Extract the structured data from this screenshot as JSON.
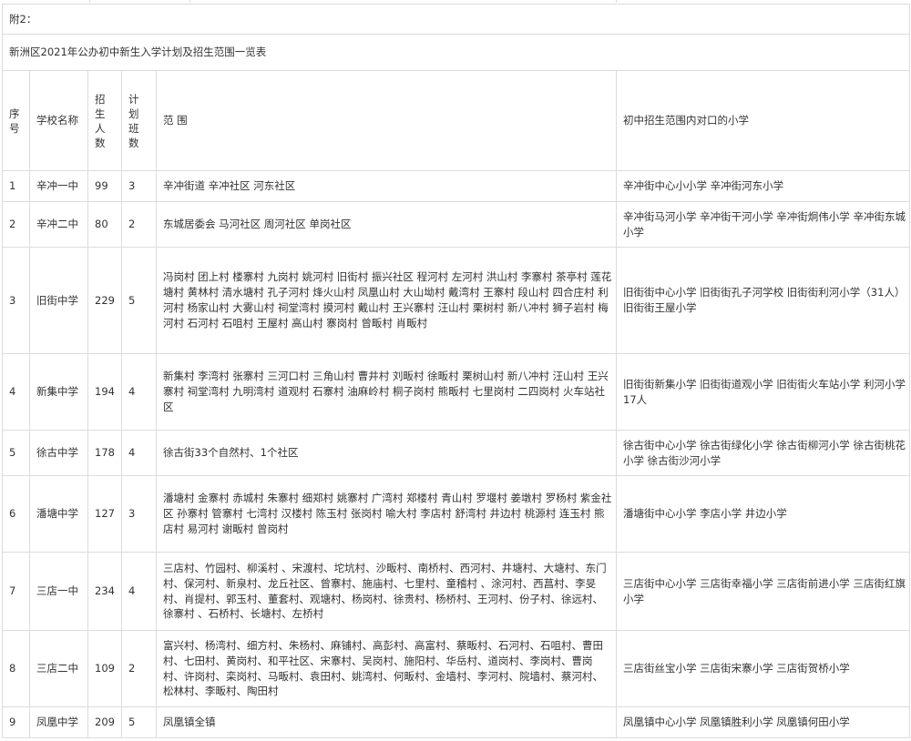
{
  "attachment_label": "附2：",
  "title": "新洲区2021年公办初中新生入学计划及招生范围一览表",
  "headers": {
    "seq": "序号",
    "school": "学校名称",
    "enroll": "招生人数",
    "plan": "计划 班数",
    "range": "范 围",
    "primary": "初中招生范围内对口的小学"
  },
  "rows": [
    {
      "seq": "1",
      "school": "辛冲一中",
      "enroll": "99",
      "classes": "3",
      "range": "辛冲街道 辛冲社区 河东社区",
      "primary": "辛冲街中心小小学 辛冲街河东小学"
    },
    {
      "seq": "2",
      "school": "辛冲二中",
      "enroll": "80",
      "classes": "2",
      "range": "东城居委会 马河社区 周河社区 单岗社区",
      "primary": "辛冲街马河小学 辛冲街干河小学 辛冲街炯伟小学 辛冲街东城小学"
    },
    {
      "seq": "3",
      "school": "旧街中学",
      "enroll": "229",
      "classes": "5",
      "range": "冯岗村 团上村 楼寨村 九岗村 姚河村 旧街村 振兴社区 程河村 左河村 洪山村 李寨村 茶亭村 莲花塘村 黄林村 清水塘村 孔子河村 烽火山村 凤凰山村 大山坳村 戴湾村 王寨村 段山村 四合庄村 利河村 杨家山村 大雾山村 祠堂湾村 摸河村 戴山村 王兴寨村 汪山村 栗树村 新八冲村 狮子岩村 梅河村 石河村 石咀村 王屋村 高山村 寨岗村 曾畈村 肖畈村",
      "primary": "旧街街中心小学 旧街街孔子河学校 旧街街利河小学（31人）旧街街王屋小学"
    },
    {
      "seq": "4",
      "school": "新集中学",
      "enroll": "194",
      "classes": "4",
      "range": "新集村 李湾村 张寨村 三河口村 三角山村 曹井村 刘畈村 徐畈村 栗树山村 新八冲村 汪山村 王兴寨村 祠堂湾村 九明湾村 道观村 石寨村 油麻岭村 桐子岗村 熊畈村 七里岗村 二四岗村 火车站社区",
      "primary": "旧街街新集小学 旧街街道观小学 旧街街火车站小学 利河小学17人"
    },
    {
      "seq": "5",
      "school": "徐古中学",
      "enroll": "178",
      "classes": "4",
      "range": "徐古街33个自然村、1个社区",
      "primary": "徐古街中心小学 徐古街绿化小学 徐古街柳河小学 徐古街桃花小学 徐古街沙河小学"
    },
    {
      "seq": "6",
      "school": "潘塘中学",
      "enroll": "127",
      "classes": "3",
      "range": "潘塘村 金寨村 赤城村 朱寨村 细郑村 姚寨村 广湾村 郑楼村 青山村 罗堰村 姜墩村 罗杨村 紫金社区 孙寨村 管寨村 七湾村 汉楼村 陈玉村 张岗村 喻大村 李店村 舒湾村 井边村 桃源村 连玉村 熊店村 易河村 谢畈村 曾岗村",
      "primary": "潘塘街中心小学 李店小学 井边小学"
    },
    {
      "seq": "7",
      "school": "三店一中",
      "enroll": "234",
      "classes": "4",
      "range": "三店村、竹园村、柳溪村 、宋渡村、坨坑村、沙畈村、南桥村、西河村、井塘村、大塘村、东门村、保河村、新泉村、龙丘社区、曾寨村、施庙村、七里村、童稽村 、涂河村、西菖村、李旻村、肖提村、郭玉村、董套村、观塘村、杨岗村、徐贵村、杨桥村、王河村、份子村、徐远村、徐寨村 、石桥村、长塘村、左桥村",
      "primary": "三店街中心小学 三店街幸福小学 三店街前进小学 三店街红旗小学"
    },
    {
      "seq": "8",
      "school": "三店二中",
      "enroll": "109",
      "classes": "2",
      "range": "富兴村、杨湾村、细方村、朱杨村、麻铺村、高彭村、高富村、蔡畈村、石河村、石咀村、曹田村、七田村、黄岗村、和平社区、宋寨村、吴岗村、施阳村、华岳村、道岗村、李岗村、曹岗村、许岗村、栾岗村、马畈村、袁田村、姚湾村、何畈村、金墙村、李河村、院墙村、蔡河村、松林村、李畈村、陶田村",
      "primary": "三店街丝宝小学 三店街宋寨小学 三店街贺桥小学"
    },
    {
      "seq": "9",
      "school": "凤凰中学",
      "enroll": "209",
      "classes": "5",
      "range": "凤凰镇全镇",
      "primary": "凤凰镇中心小学 凤凰镇胜利小学 凤凰镇何田小学"
    }
  ]
}
